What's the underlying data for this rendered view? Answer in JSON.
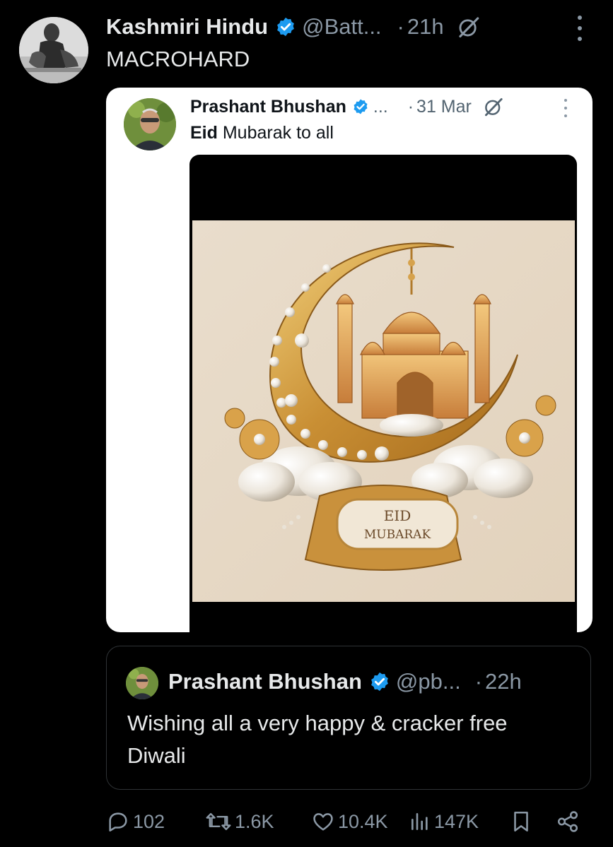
{
  "tweet": {
    "display_name": "Kashmiri Hindu",
    "handle": "@Batt...",
    "separator": "·",
    "time": "21h",
    "text": "MACROHARD"
  },
  "screenshot_card": {
    "display_name": "Prashant Bhushan",
    "handle_truncated": "...",
    "separator": "·",
    "date": "31 Mar",
    "text_bold": "Eid",
    "text_rest": " Mubarak to all",
    "image_text_line1": "EID",
    "image_text_line2": "MUBARAK"
  },
  "quoted_tweet": {
    "display_name": "Prashant Bhushan",
    "handle": "@pb...",
    "separator": "·",
    "time": "22h",
    "text": "Wishing all a very happy & cracker free Diwali"
  },
  "actions": {
    "replies": "102",
    "reposts": "1.6K",
    "likes": "10.4K",
    "views": "147K"
  },
  "colors": {
    "background": "#000000",
    "primary_text": "#e7e9ea",
    "secondary_text": "#8b98a5",
    "verified_blue": "#1d9bf0",
    "card_border": "#2f3336"
  },
  "icons": {
    "verified": "verified-badge-icon",
    "grok": "grok-icon",
    "more": "more-options-icon",
    "reply": "reply-icon",
    "repost": "repost-icon",
    "like": "like-icon",
    "views": "views-icon",
    "bookmark": "bookmark-icon",
    "share": "share-icon"
  }
}
